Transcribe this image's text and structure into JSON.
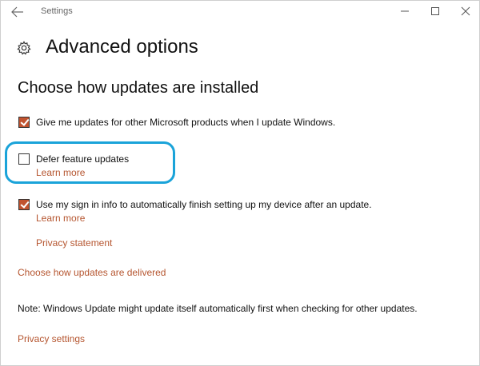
{
  "titlebar": {
    "app_title": "Settings"
  },
  "header": {
    "page_title": "Advanced options"
  },
  "section": {
    "heading": "Choose how updates are installed"
  },
  "options": [
    {
      "label": "Give me updates for other Microsoft products when I update Windows.",
      "checked": true
    },
    {
      "label": "Defer feature updates",
      "checked": false,
      "link": "Learn more"
    },
    {
      "label": "Use my sign in info to automatically finish setting up my device after an update.",
      "checked": true,
      "link": "Learn more"
    }
  ],
  "links": {
    "privacy_statement": "Privacy statement",
    "delivery": "Choose how updates are delivered",
    "privacy_settings": "Privacy settings"
  },
  "note": "Note: Windows Update might update itself automatically first when checking for other updates.",
  "colors": {
    "accent": "#c1532f",
    "link": "#b5552f",
    "highlight": "#1aa3d9"
  },
  "icons": {
    "back": "back-arrow-icon",
    "gear": "gear-icon",
    "minimize": "minimize-icon",
    "maximize": "maximize-icon",
    "close": "close-icon"
  }
}
